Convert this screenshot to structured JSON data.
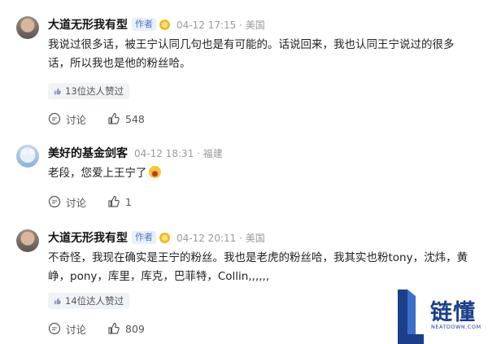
{
  "comments": [
    {
      "author": "大道无形我有型",
      "author_tag": "作者",
      "meta": "04-12 17:15 · 美国",
      "text": "我说过很多话，被王宁认同几句也是有可能的。话说回来，我也认同王宁说过的很多话，所以我也是他的粉丝哈。",
      "endorse_label": "13位达人赞过",
      "discuss_label": "讨论",
      "like_count": "548"
    },
    {
      "author": "美好的基金剑客",
      "meta": "04-12 18:31 · 福建",
      "text": "老段，您爱上王宁了",
      "emoji": "laughing-emoji",
      "discuss_label": "讨论",
      "like_count": "1"
    },
    {
      "author": "大道无形我有型",
      "author_tag": "作者",
      "meta": "04-12 20:11 · 美国",
      "text": "不奇怪，我现在确实是王宁的粉丝。我也是老虎的粉丝哈，我其实也粉tony，沈炜，黄峥，pony，库里，库克，巴菲特，Collin,,,,,,",
      "endorse_label": "14位达人赞过",
      "discuss_label": "讨论",
      "like_count": "809"
    }
  ],
  "watermark": {
    "brand": "链懂",
    "site": "NEATDOWN.COM"
  },
  "colors": {
    "accent": "#4a76c2",
    "brand": "#1b3f8b",
    "meta_gray": "#9a9a9a"
  }
}
